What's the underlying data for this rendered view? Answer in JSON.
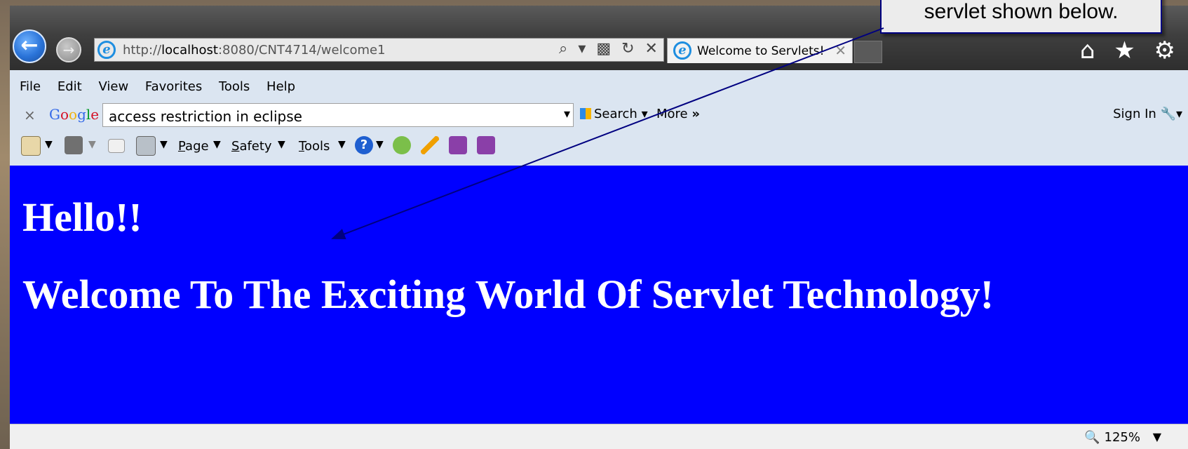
{
  "browser": {
    "url_prefix": "http://",
    "url_host": "localhost",
    "url_rest": ":8080/CNT4714/welcome1",
    "address_controls": "⌕ ▾ ▩ ↻ ✕",
    "tab_title": "Welcome to Servlets!",
    "tab_close": "✕",
    "right_icons": "⌂ ★ ⚙"
  },
  "menu": [
    "File",
    "Edit",
    "View",
    "Favorites",
    "Tools",
    "Help"
  ],
  "google_bar": {
    "close": "×",
    "logo": "Google",
    "query": "access restriction in eclipse",
    "search_label": "Search",
    "more_label": "More",
    "sign_in": "Sign In"
  },
  "command_bar": {
    "page": "Page",
    "safety": "Safety",
    "tools": "Tools"
  },
  "page": {
    "heading1": "Hello!!",
    "heading2": "Welcome To The Exciting World Of Servlet Technology!",
    "background_color": "#0000ff"
  },
  "status": {
    "zoom": "125%"
  },
  "annotation": {
    "callout_text": "servlet shown below."
  }
}
